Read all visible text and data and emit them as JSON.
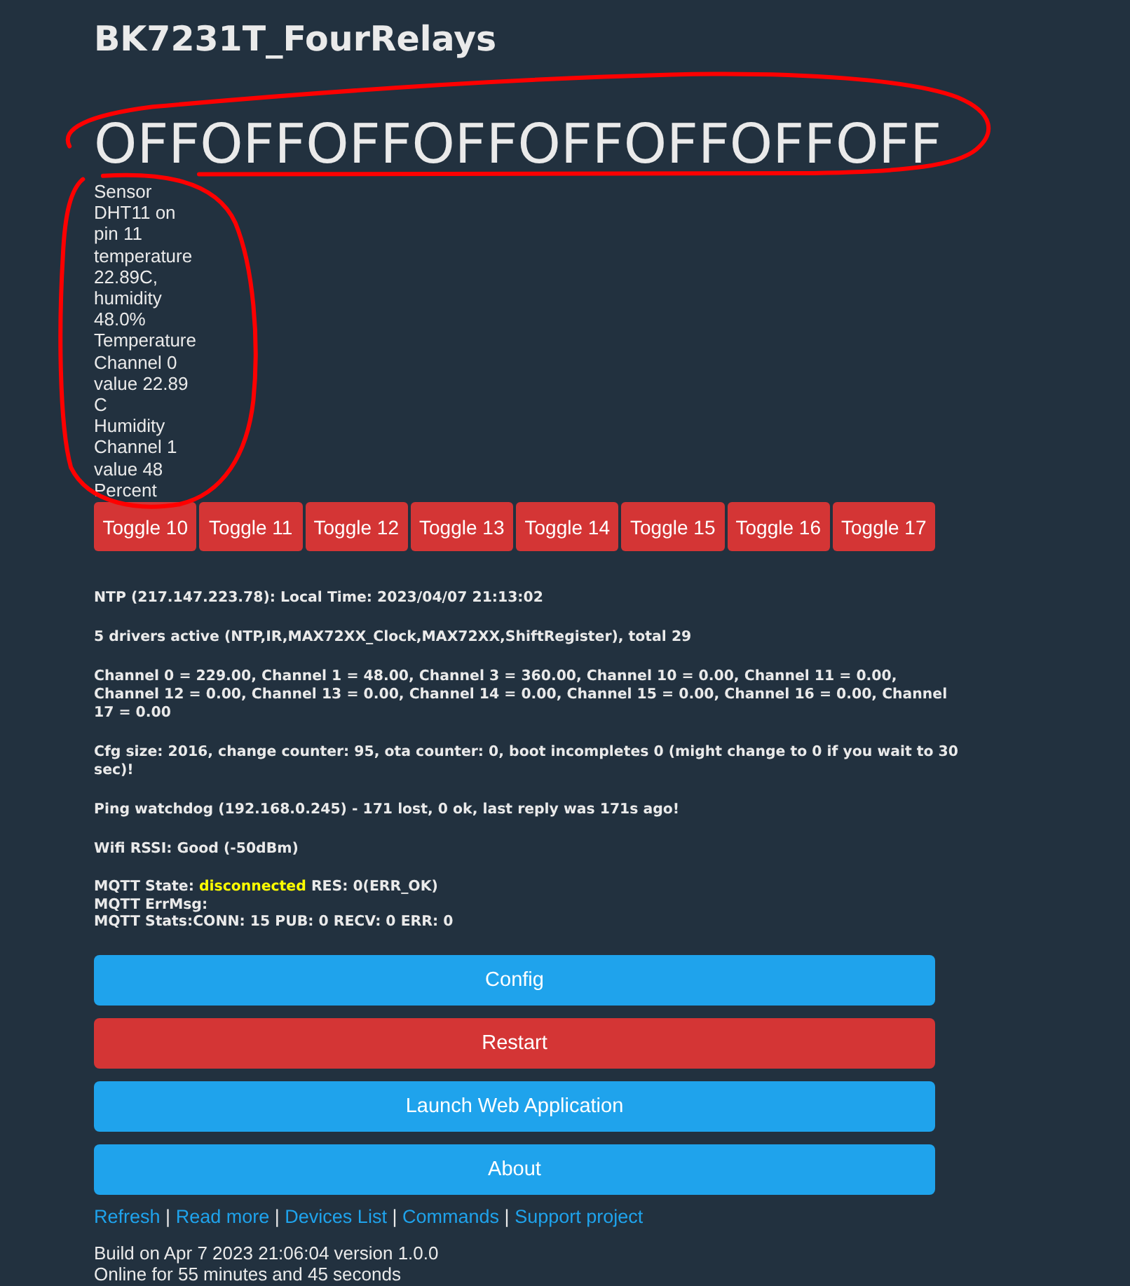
{
  "title": "BK7231T_FourRelays",
  "relay_states": {
    "circled": true,
    "items": [
      "OFF",
      "OFF",
      "OFF",
      "OFF",
      "OFF",
      "OFF",
      "OFF",
      "OFF"
    ]
  },
  "sensor": {
    "circled": true,
    "lines": [
      "Sensor DHT11 on pin 11 temperature 22.89C, humidity 48.0%",
      "Temperature Channel 0 value 22.89 C",
      "Humidity Channel 1 value 48 Percent"
    ]
  },
  "toggles": [
    {
      "label": "Toggle 10",
      "on": false
    },
    {
      "label": "Toggle 11",
      "on": false
    },
    {
      "label": "Toggle 12",
      "on": false
    },
    {
      "label": "Toggle 13",
      "on": false
    },
    {
      "label": "Toggle 14",
      "on": false
    },
    {
      "label": "Toggle 15",
      "on": false
    },
    {
      "label": "Toggle 16",
      "on": false
    },
    {
      "label": "Toggle 17",
      "on": false
    }
  ],
  "info": [
    "NTP (217.147.223.78): Local Time: 2023/04/07 21:13:02",
    "5 drivers active (NTP,IR,MAX72XX_Clock,MAX72XX,ShiftRegister), total 29",
    "Channel 0 = 229.00, Channel 1 = 48.00, Channel 3 = 360.00, Channel 10 = 0.00, Channel 11 = 0.00, Channel 12 = 0.00, Channel 13 = 0.00, Channel 14 = 0.00, Channel 15 = 0.00, Channel 16 = 0.00, Channel 17 = 0.00",
    "Cfg size: 2016, change counter: 95, ota counter: 0, boot incompletes 0 (might change to 0 if you wait to 30 sec)!",
    "Ping watchdog (192.168.0.245) - 171 lost, 0 ok, last reply was 171s ago!",
    "Wifi RSSI: Good (-50dBm)"
  ],
  "mqtt": {
    "state_label": "MQTT State:",
    "state": "disconnected",
    "connected": false,
    "result": "RES: 0(ERR_OK)",
    "lines": [
      "MQTT ErrMsg:",
      "MQTT Stats:CONN: 15 PUB: 0 RECV: 0 ERR: 0"
    ]
  },
  "buttons": [
    {
      "label": "Config",
      "kind": "primary"
    },
    {
      "label": "Restart",
      "kind": "danger"
    },
    {
      "label": "Launch Web Application",
      "kind": "primary"
    },
    {
      "label": "About",
      "kind": "primary"
    }
  ],
  "footer_links": [
    {
      "kind": "link",
      "text": "Refresh"
    },
    {
      "kind": "separator",
      "text": "|"
    },
    {
      "kind": "link",
      "text": "Read more"
    },
    {
      "kind": "separator",
      "text": "|"
    },
    {
      "kind": "link",
      "text": "Devices List"
    },
    {
      "kind": "separator",
      "text": "|"
    },
    {
      "kind": "link",
      "text": "Commands"
    },
    {
      "kind": "separator",
      "text": "|"
    },
    {
      "kind": "link",
      "text": "Support project"
    }
  ],
  "build": [
    "Build on Apr 7 2023 21:06:04 version 1.0.0",
    "Online for 55 minutes and 45 seconds"
  ]
}
